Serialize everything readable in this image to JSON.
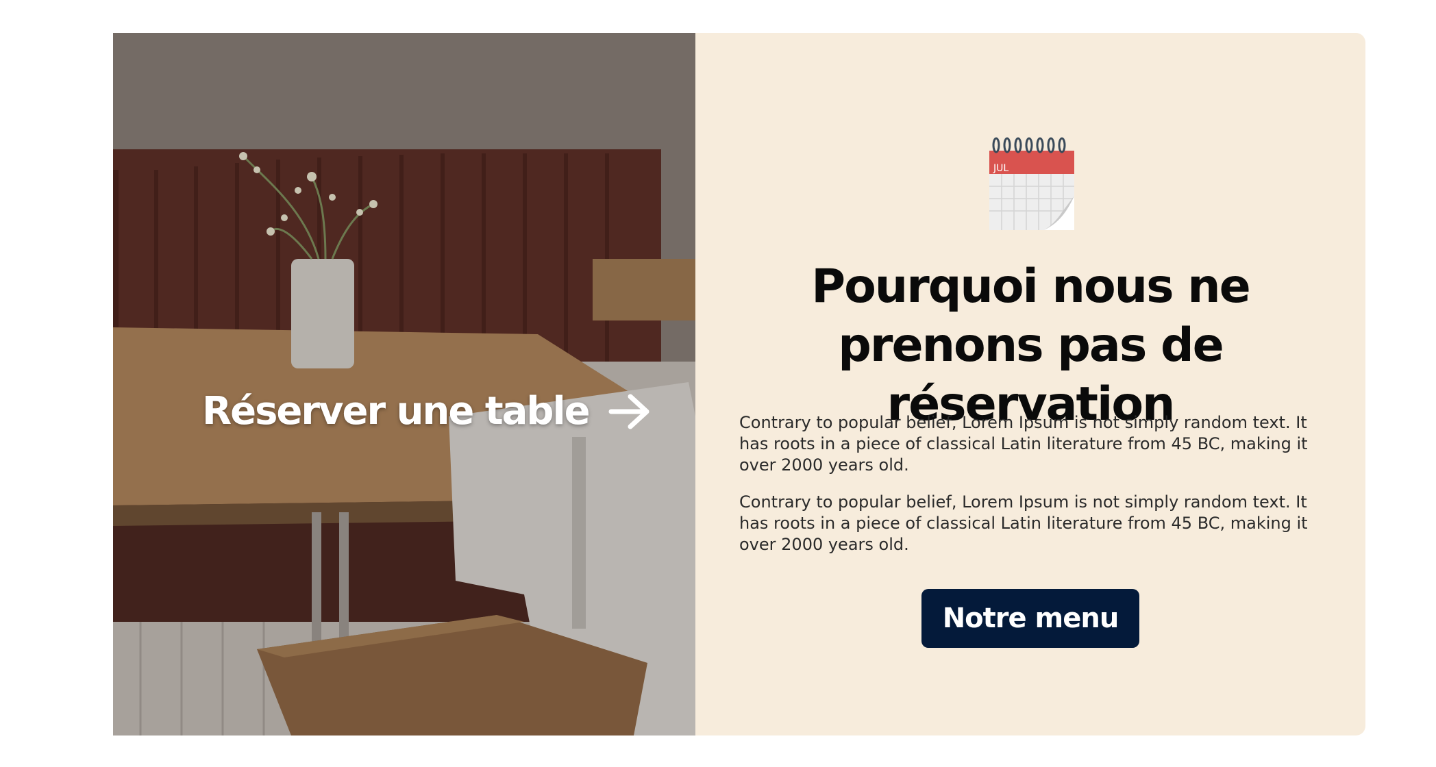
{
  "promo": {
    "reserve_label": "Réserver une table",
    "reserve_icon": "arrow-right-icon",
    "calendar_icon": "calendar-icon",
    "calendar_month": "JUL",
    "title": "Pourquoi nous ne prenons pas de réservation",
    "paragraphs": [
      "Contrary to popular belief, Lorem Ipsum is not simply random text. It has roots in a piece of classical Latin literature from 45 BC, making it over 2000 years old.",
      "Contrary to popular belief, Lorem Ipsum is not simply random text. It has roots in a piece of classical Latin literature from 45 BC, making it over 2000 years old."
    ],
    "menu_button_label": "Notre menu"
  },
  "colors": {
    "panel_background": "#f7ecdc",
    "button_background": "#041a3a",
    "button_text": "#ffffff",
    "calendar_header": "#d9534f"
  }
}
